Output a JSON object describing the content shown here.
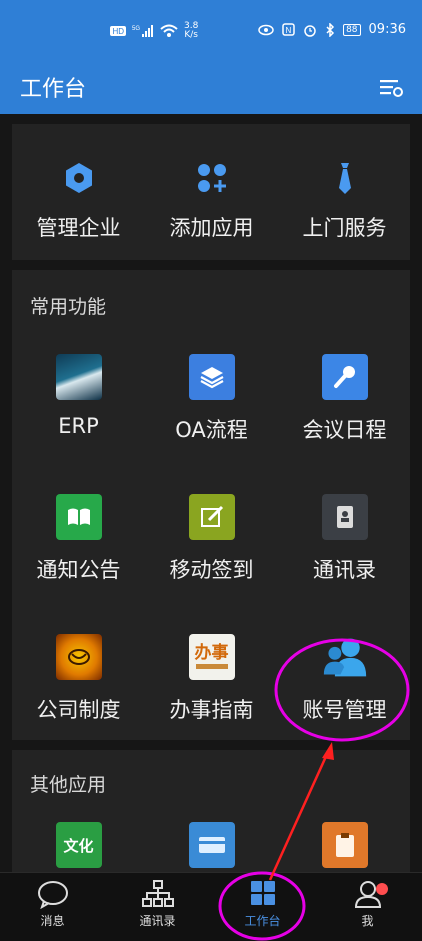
{
  "status_bar": {
    "network_speed_value": "3.8",
    "network_speed_unit": "K/s",
    "battery": "88",
    "time": "09:36"
  },
  "app_bar": {
    "title": "工作台"
  },
  "top_row": [
    {
      "label": "管理企业",
      "icon": "hexagon-icon"
    },
    {
      "label": "添加应用",
      "icon": "add-app-icon"
    },
    {
      "label": "上门服务",
      "icon": "tie-icon"
    }
  ],
  "common": {
    "title": "常用功能",
    "items": [
      {
        "label": "ERP",
        "icon": "erp-logo-icon"
      },
      {
        "label": "OA流程",
        "icon": "layers-icon"
      },
      {
        "label": "会议日程",
        "icon": "microphone-icon"
      },
      {
        "label": "通知公告",
        "icon": "book-icon"
      },
      {
        "label": "移动签到",
        "icon": "edit-icon"
      },
      {
        "label": "通讯录",
        "icon": "contacts-icon"
      },
      {
        "label": "公司制度",
        "icon": "company-policy-icon"
      },
      {
        "label": "办事指南",
        "icon": "guide-icon",
        "icon_text": "办事"
      },
      {
        "label": "账号管理",
        "icon": "account-icon"
      }
    ]
  },
  "other": {
    "title": "其他应用",
    "items": [
      {
        "label": "",
        "icon": "culture-icon",
        "icon_text": "文化"
      },
      {
        "label": "",
        "icon": "card-icon"
      },
      {
        "label": "",
        "icon": "clipboard-icon"
      }
    ]
  },
  "tabs": [
    {
      "label": "消息",
      "icon": "chat-icon",
      "active": false
    },
    {
      "label": "通讯录",
      "icon": "org-chart-icon",
      "active": false
    },
    {
      "label": "工作台",
      "icon": "grid-icon",
      "active": true
    },
    {
      "label": "我",
      "icon": "profile-icon",
      "active": false,
      "badge": true
    }
  ],
  "colors": {
    "primary": "#2f7fd6",
    "annotation": "#e600e6",
    "arrow": "#ff2020"
  }
}
